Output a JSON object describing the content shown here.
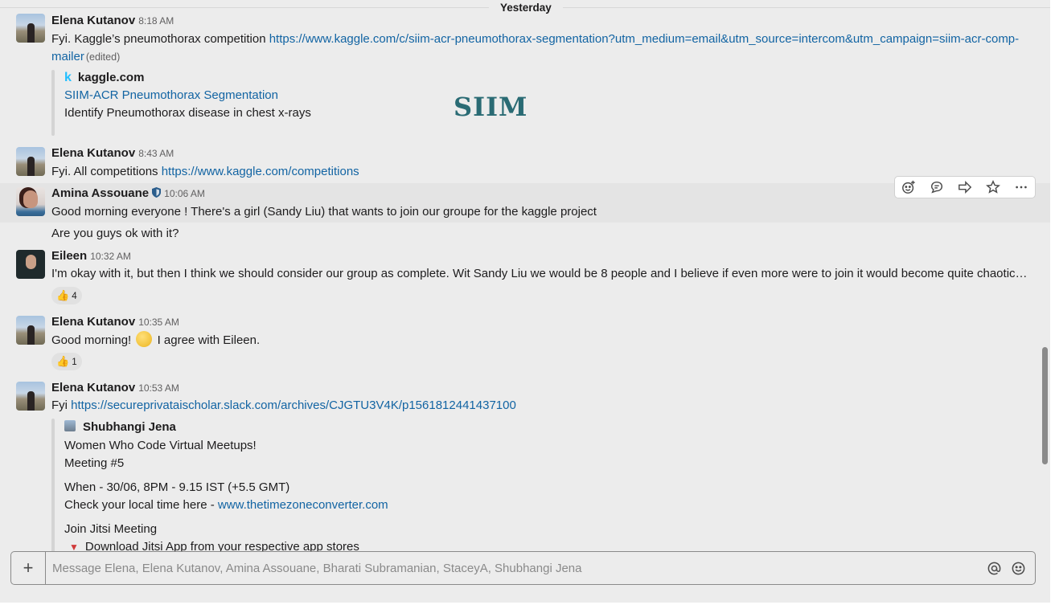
{
  "date_divider": "Yesterday",
  "messages": [
    {
      "sender": "Elena Kutanov",
      "time": "8:18 AM",
      "text_prefix": "Fyi. Kaggle’s pneumothorax competition ",
      "link_part1": "https://www.kaggle.com/c/siim-acr-pneumothorax-segmentation?utm_medium=email&utm_source=intercom&utm_campaign=siim-acr-comp-",
      "link_part2": "mailer",
      "edited": "(edited)",
      "unfurl": {
        "site": "kaggle.com",
        "title": "SIIM-ACR Pneumothorax Segmentation",
        "description": "Identify Pneumothorax disease in chest x-rays",
        "logo_text": "SIIM"
      }
    },
    {
      "sender": "Elena Kutanov",
      "time": "8:43 AM",
      "text_prefix": "Fyi. All competitions ",
      "link": "https://www.kaggle.com/competitions"
    },
    {
      "sender": "Amina Assouane",
      "time": "10:06 AM",
      "text": "Good morning everyone ! There's a girl (Sandy Liu) that wants to join our groupe for the kaggle project",
      "followup": "Are you guys ok with it?"
    },
    {
      "sender": "Eileen",
      "time": "10:32 AM",
      "text": "I'm okay with it, but then I think we should consider our group as complete. Wit Sandy Liu we would be 8 people and I believe if even more were to join it would become quite chaotic…",
      "reaction_count": "4"
    },
    {
      "sender": "Elena Kutanov",
      "time": "10:35 AM",
      "text_before": "Good morning!",
      "text_after": "I agree with Eileen.",
      "reaction_count": "1"
    },
    {
      "sender": "Elena Kutanov",
      "time": "10:53 AM",
      "text_prefix": "Fyi ",
      "link": "https://secureprivataischolar.slack.com/archives/CJGTU3V4K/p1561812441437100",
      "shared": {
        "author": "Shubhangi Jena",
        "line1": "Women Who Code Virtual Meetups!",
        "line2": "Meeting #5",
        "line3": "When - 30/06, 8PM - 9.15  IST (+5.5 GMT)",
        "line4_prefix": "Check your local time here - ",
        "line4_link": "www.thetimezoneconverter.com",
        "line5": "Join Jitsi Meeting",
        "line6": "Download Jitsi App from your respective app stores"
      }
    }
  ],
  "reaction_emoji": "👍",
  "composer": {
    "placeholder": "Message Elena, Elena Kutanov, Amina Assouane, Bharati Subramanian, StaceyA, Shubhangi Jena"
  },
  "icons": {
    "toolbar": [
      "add-reaction-icon",
      "reply-thread-icon",
      "share-icon",
      "star-icon",
      "more-actions-icon"
    ],
    "composer": [
      "plus-icon",
      "mention-icon",
      "emoji-icon"
    ]
  }
}
